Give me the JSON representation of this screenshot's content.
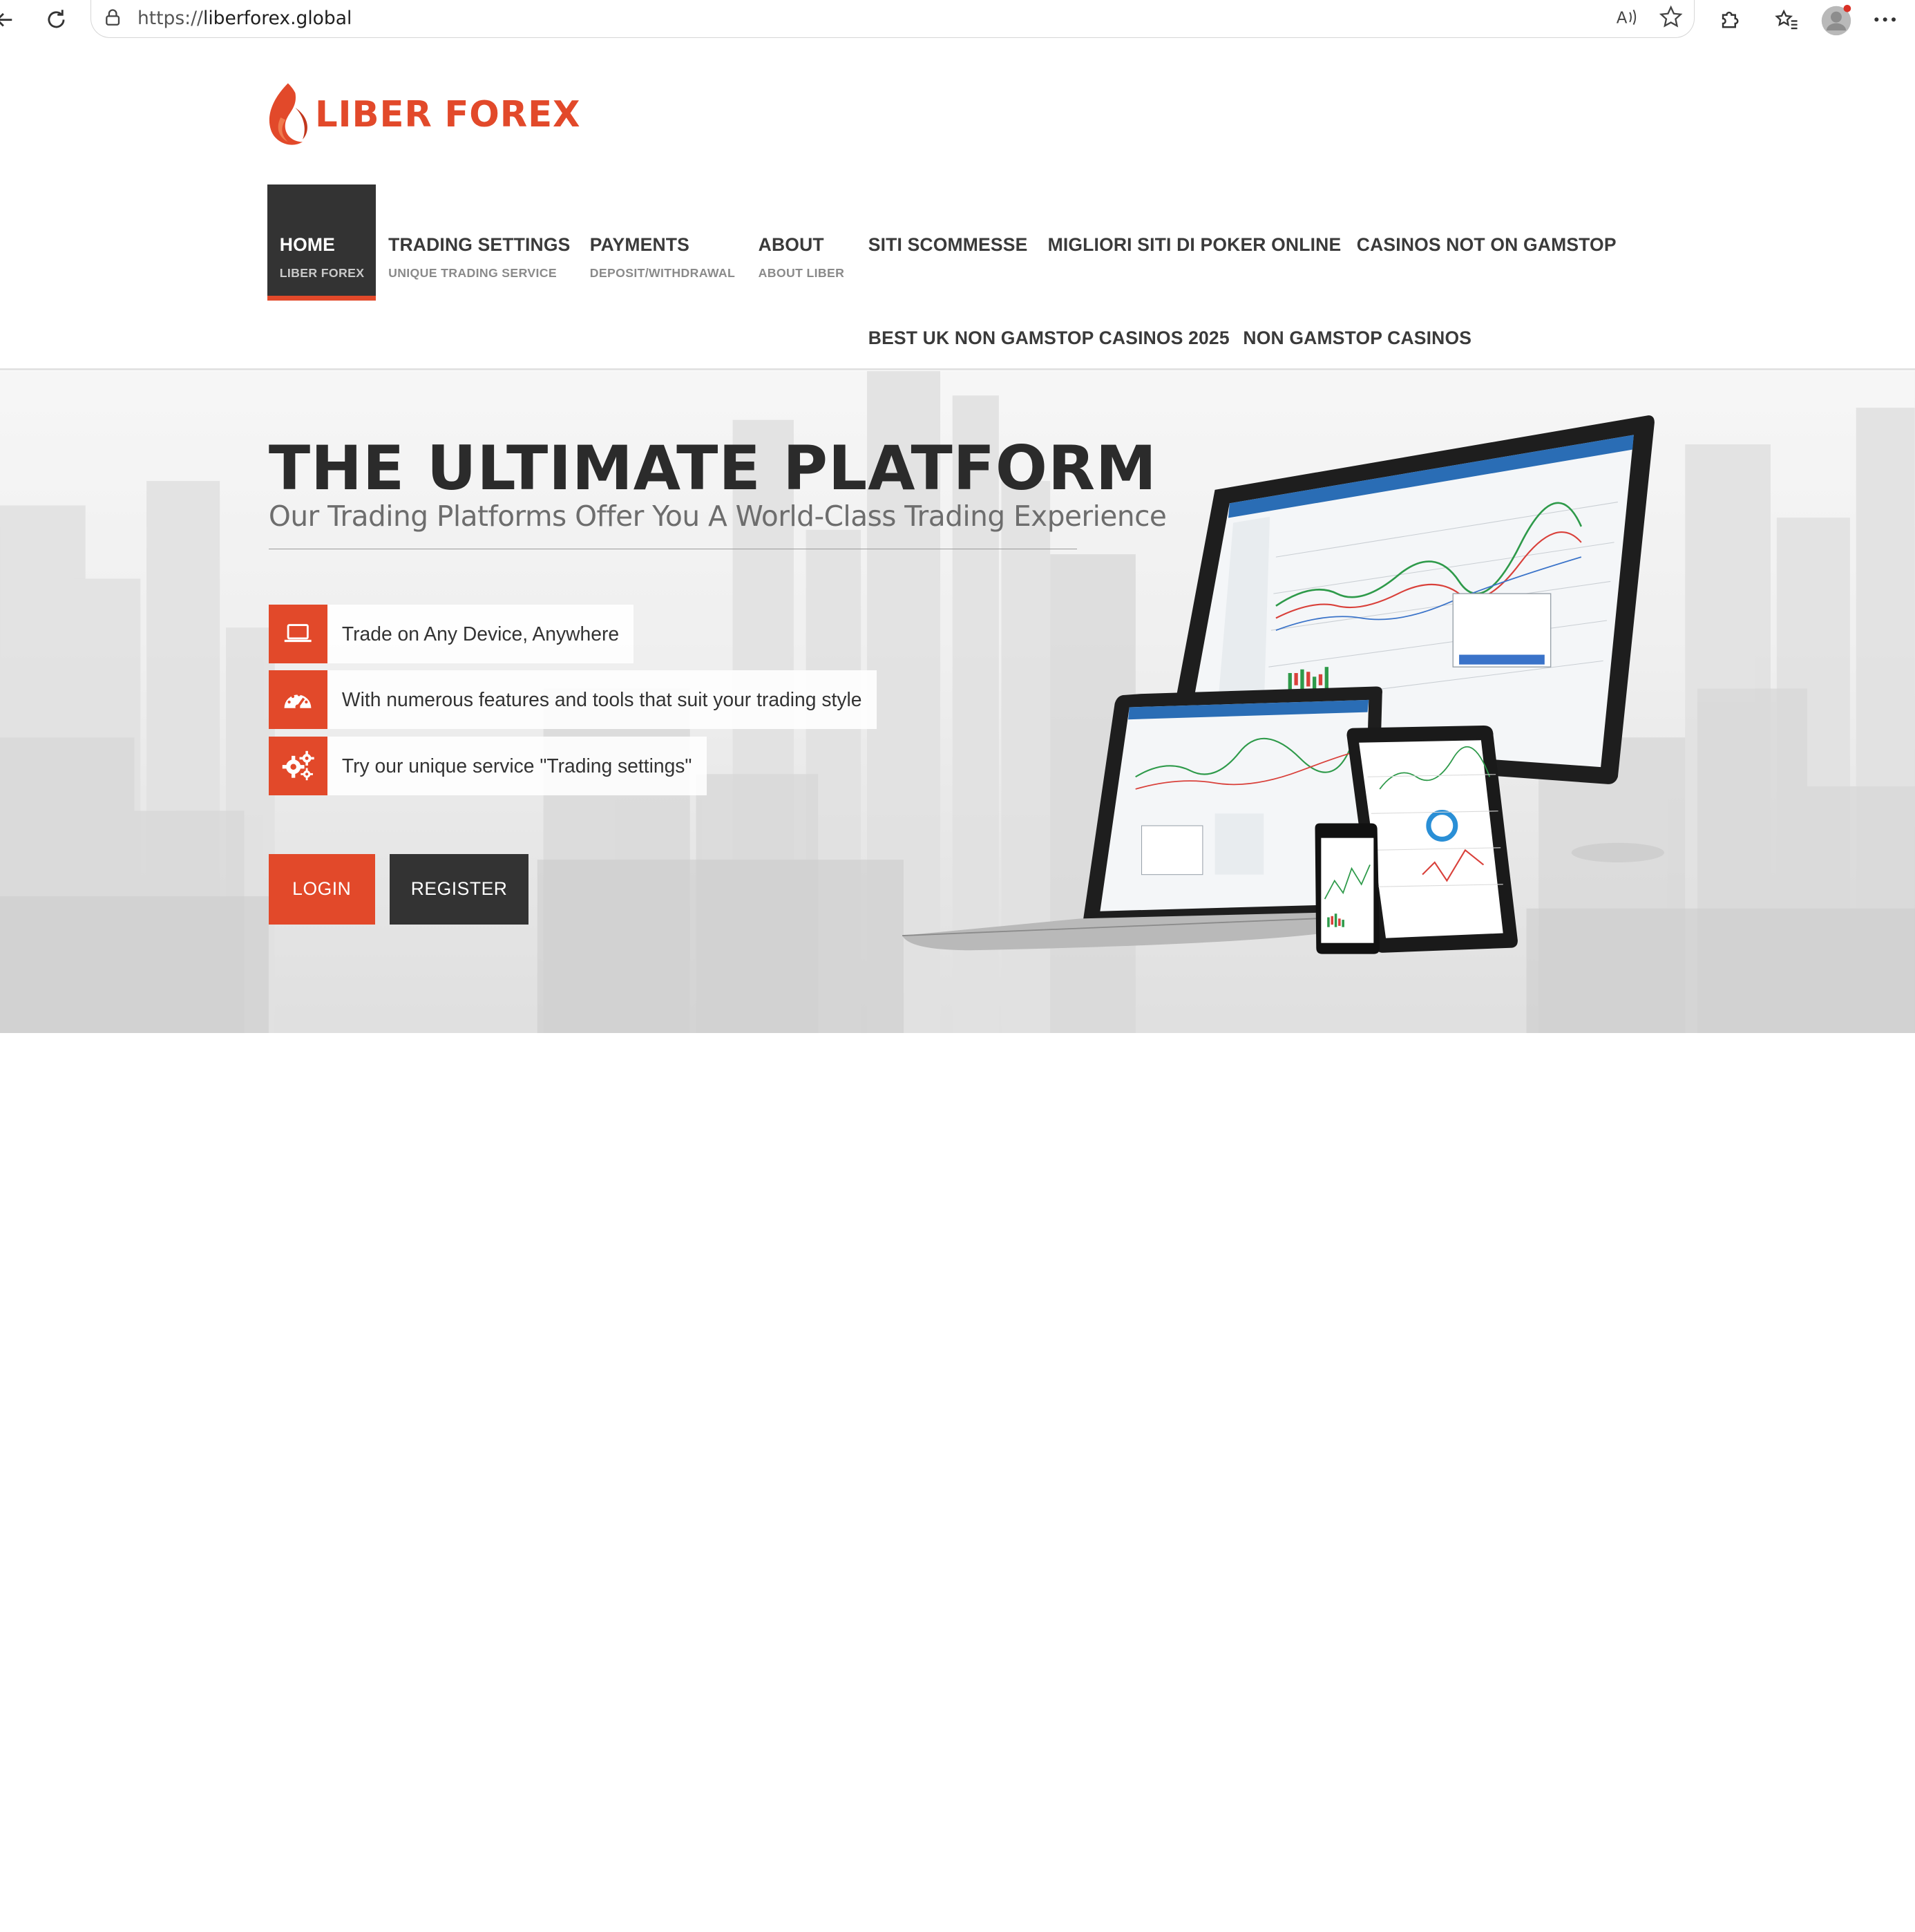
{
  "browser": {
    "url_protocol": "https://",
    "url_host": "liberforex.global"
  },
  "logo": {
    "word1": "LIBER",
    "word2": "FOREX"
  },
  "nav": [
    {
      "label": "HOME",
      "sub": "LIBER FOREX"
    },
    {
      "label": "TRADING SETTINGS",
      "sub": "UNIQUE TRADING SERVICE"
    },
    {
      "label": "PAYMENTS",
      "sub": "DEPOSIT/WITHDRAWAL"
    },
    {
      "label": "ABOUT",
      "sub": "ABOUT LIBER"
    },
    {
      "label": "SITI SCOMMESSE"
    },
    {
      "label": "MIGLIORI SITI DI POKER ONLINE"
    },
    {
      "label": "CASINOS NOT ON GAMSTOP"
    },
    {
      "label": "BEST UK NON GAMSTOP CASINOS 2025"
    },
    {
      "label": "NON GAMSTOP CASINOS"
    }
  ],
  "hero": {
    "title": "THE ULTIMATE PLATFORM",
    "subtitle": "Our Trading Platforms Offer You A World-Class Trading Experience",
    "features": [
      {
        "icon": "laptop-icon",
        "text": "Trade on Any Device, Anywhere"
      },
      {
        "icon": "speedometer-icon",
        "text": "With numerous features and tools that suit your trading style"
      },
      {
        "icon": "gears-icon",
        "text": "Try our unique service \"Trading settings\""
      }
    ],
    "login_label": "LOGIN",
    "register_label": "REGISTER"
  },
  "colors": {
    "accent": "#e2492a",
    "dark": "#333333"
  }
}
